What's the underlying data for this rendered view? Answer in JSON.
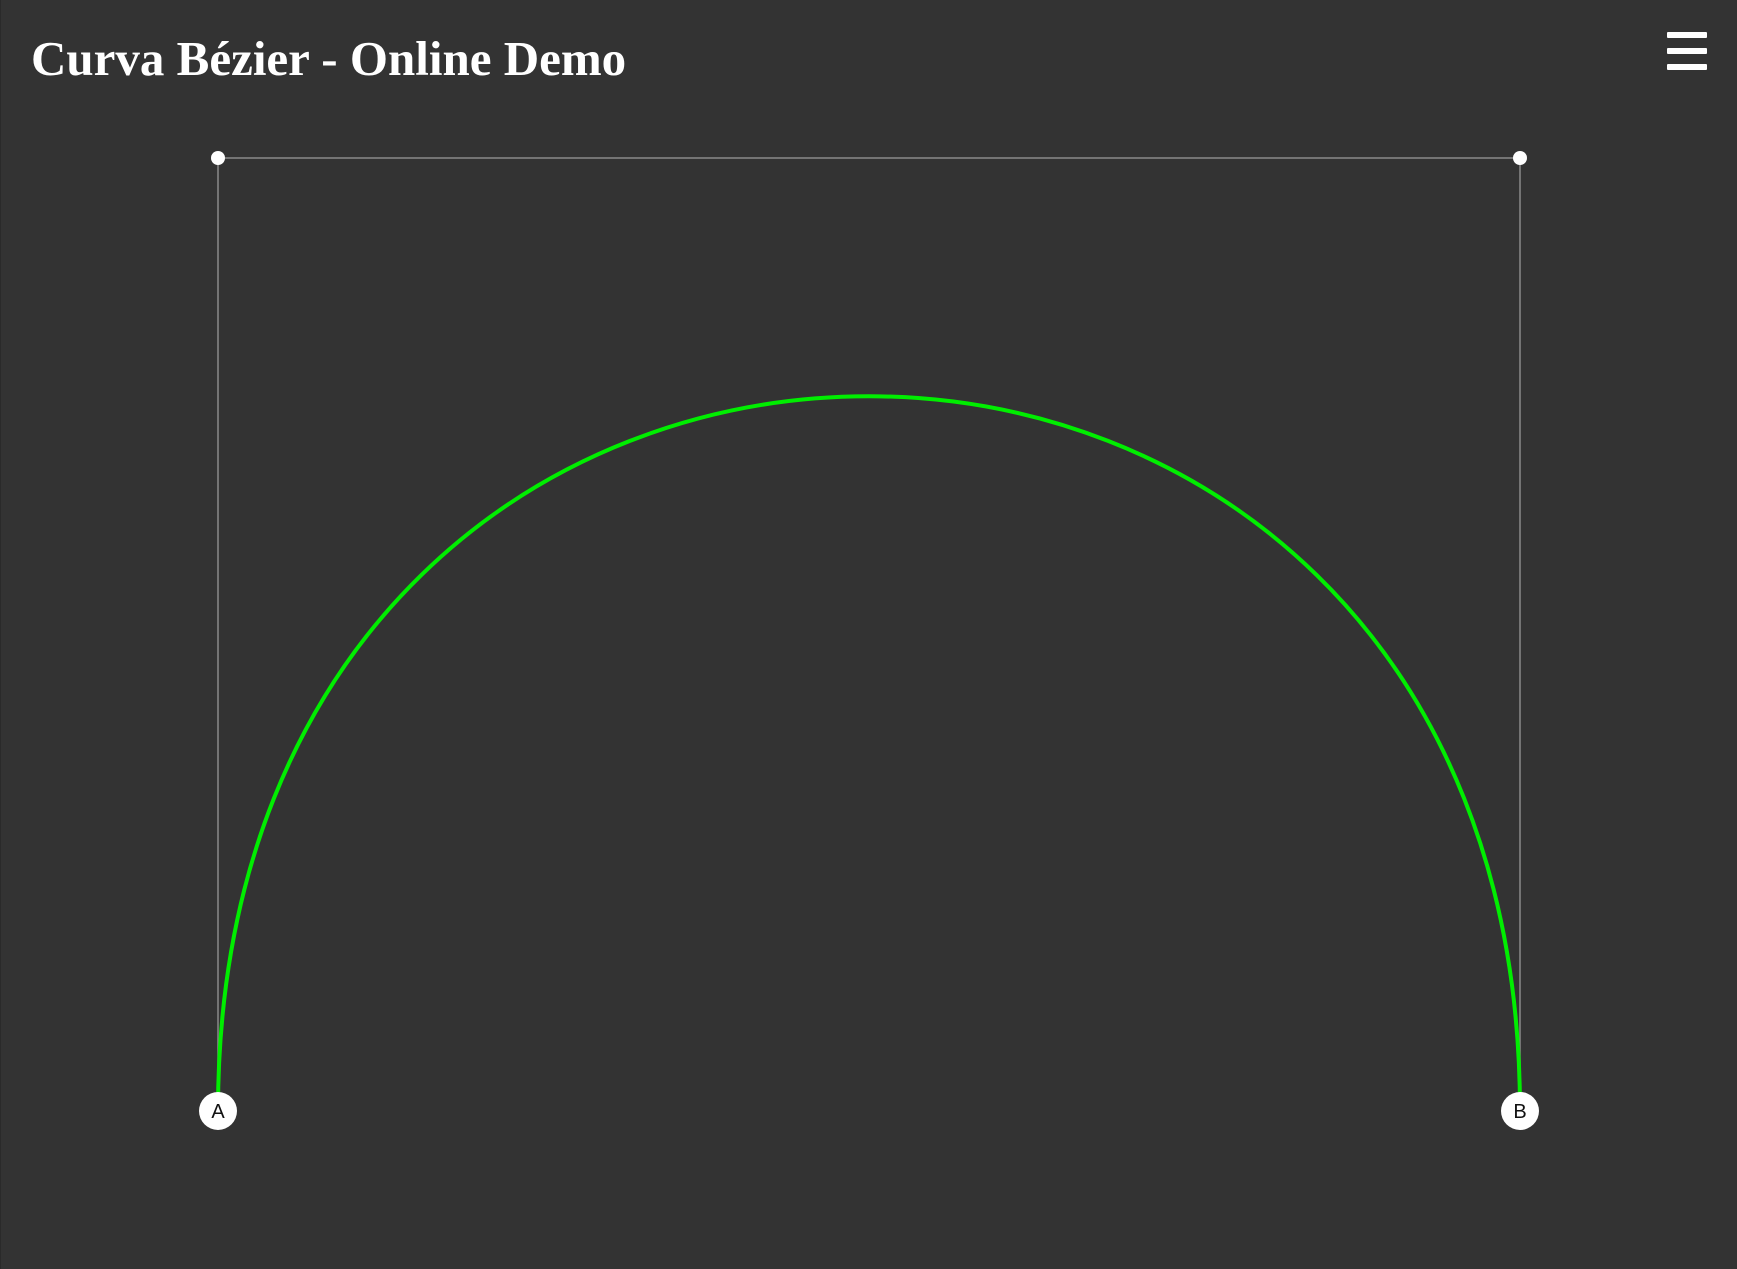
{
  "app": {
    "title": "Curva Bézier - Online Demo"
  },
  "menu": {
    "icon": "hamburger-menu-icon"
  },
  "bezier": {
    "start_point": {
      "label": "A"
    },
    "end_point": {
      "label": "B"
    },
    "curve_color": "#00ee00",
    "control_line_color": "#8a8a8a",
    "handle_color": "#ffffff"
  }
}
